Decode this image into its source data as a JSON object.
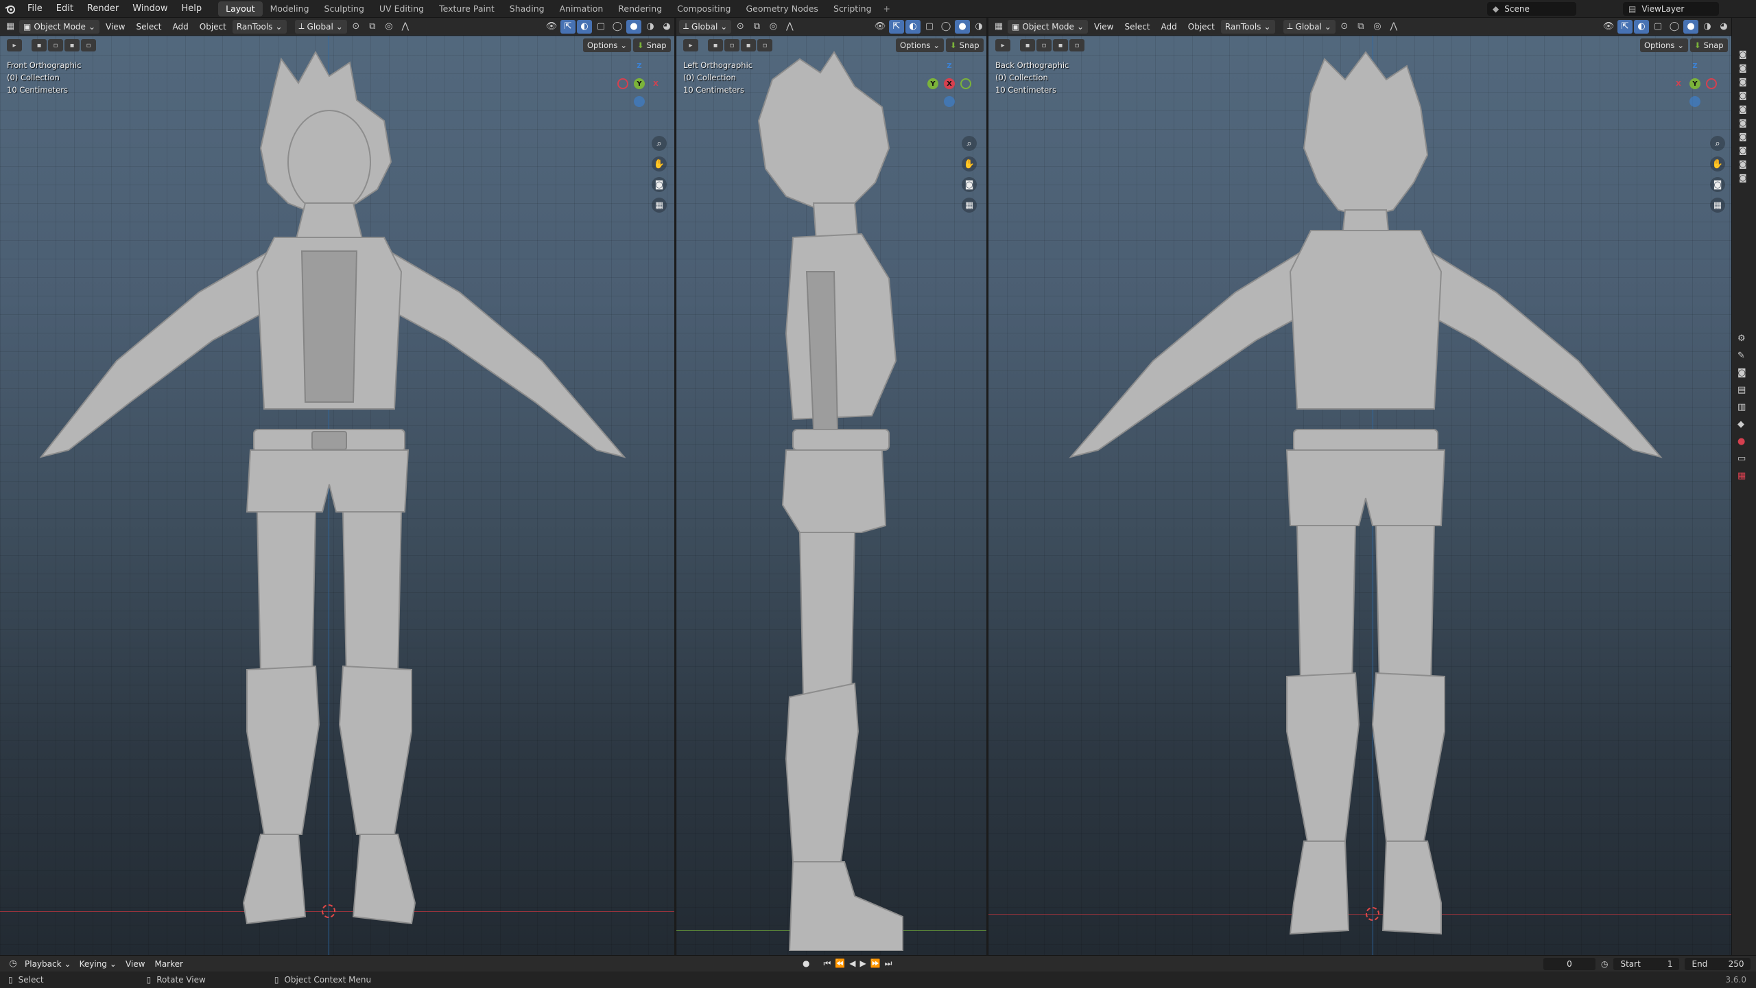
{
  "topbar": {
    "menus": [
      "File",
      "Edit",
      "Render",
      "Window",
      "Help"
    ],
    "workspaces": [
      "Layout",
      "Modeling",
      "Sculpting",
      "UV Editing",
      "Texture Paint",
      "Shading",
      "Animation",
      "Rendering",
      "Compositing",
      "Geometry Nodes",
      "Scripting"
    ],
    "active_workspace": "Layout",
    "scene": "Scene",
    "view_layer": "ViewLayer"
  },
  "viewports": [
    {
      "mode": "Object Mode",
      "menus": [
        "View",
        "Select",
        "Add",
        "Object",
        "RanTools"
      ],
      "orientation": "Global",
      "options_label": "Options",
      "snap_label": "Snap",
      "view_name": "Front Orthographic",
      "collection": "(0) Collection",
      "scale": "10 Centimeters"
    },
    {
      "orientation": "Global",
      "options_label": "Options",
      "snap_label": "Snap",
      "view_name": "Left Orthographic",
      "collection": "(0) Collection",
      "scale": "10 Centimeters"
    },
    {
      "mode": "Object Mode",
      "menus": [
        "View",
        "Select",
        "Add",
        "Object",
        "RanTools"
      ],
      "orientation": "Global",
      "options_label": "Options",
      "snap_label": "Snap",
      "view_name": "Back Orthographic",
      "collection": "(0) Collection",
      "scale": "10 Centimeters"
    }
  ],
  "gizmo_labels": {
    "z": "Z",
    "y": "Y",
    "x": "X"
  },
  "timeline": {
    "menus": [
      "Playback",
      "Keying",
      "View",
      "Marker"
    ],
    "current_frame": "0",
    "start_label": "Start",
    "start": "1",
    "end_label": "End",
    "end": "250"
  },
  "statusbar": {
    "select": "Select",
    "rotate": "Rotate View",
    "context": "Object Context Menu",
    "version": "3.6.0"
  },
  "colors": {
    "x_axis": "#d6404f",
    "y_axis": "#7bb33a",
    "z_axis": "#3b82d6",
    "accent": "#4772b3"
  }
}
